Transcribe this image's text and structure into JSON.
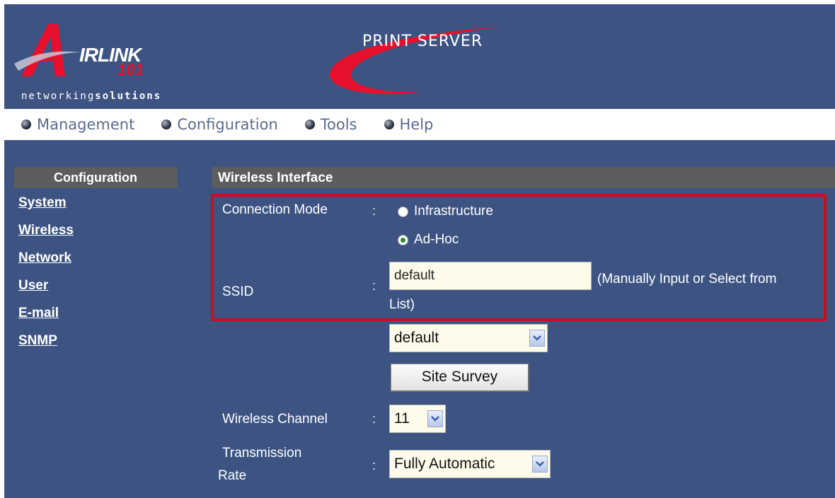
{
  "brand": {
    "logo_word": "IRLINK",
    "logo_number": "101",
    "tagline_light": "networking",
    "tagline_bold": "solutions",
    "product_title": "PRINT SERVER"
  },
  "nav": [
    {
      "label": "Management"
    },
    {
      "label": "Configuration"
    },
    {
      "label": "Tools"
    },
    {
      "label": "Help"
    }
  ],
  "sidebar": {
    "title": "Configuration",
    "links": [
      {
        "label": "System"
      },
      {
        "label": "Wireless"
      },
      {
        "label": "Network"
      },
      {
        "label": "User"
      },
      {
        "label": "E-mail"
      },
      {
        "label": "SNMP"
      }
    ]
  },
  "main": {
    "section_title": "Wireless Interface",
    "connection_mode": {
      "label": "Connection Mode",
      "colon": ":",
      "options": [
        "Infrastructure",
        "Ad-Hoc"
      ],
      "selected": "Ad-Hoc"
    },
    "ssid": {
      "label": "SSID",
      "colon": ":",
      "value": "default",
      "hint_line1": "(Manually Input or Select from",
      "hint_line2": "List)",
      "select_value": "default",
      "site_survey_label": "Site Survey"
    },
    "wireless_channel": {
      "label": "Wireless Channel",
      "colon": ":",
      "value": "11"
    },
    "transmission_rate": {
      "label_line1": "Transmission",
      "label_line2": "Rate",
      "colon": ":",
      "value": "Fully Automatic"
    }
  },
  "colors": {
    "background": "#3d5483",
    "header_bar": "#5d5d5d",
    "highlight_border": "#c8101e",
    "brand_red": "#e8112d"
  }
}
